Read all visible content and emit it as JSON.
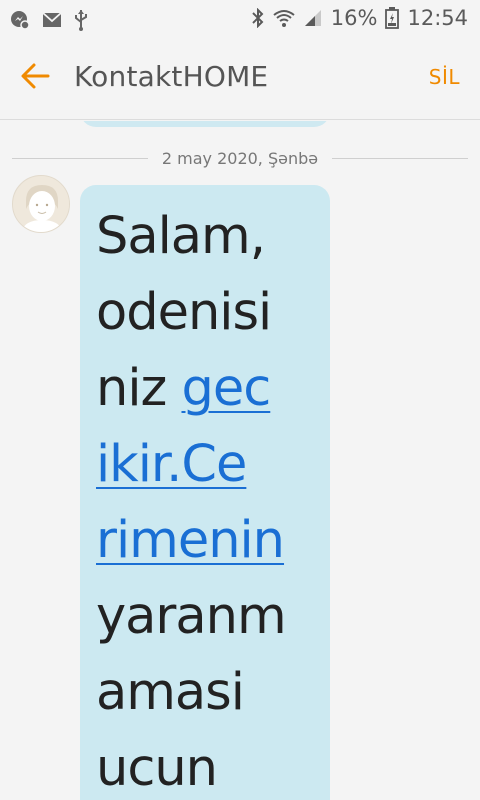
{
  "status_bar": {
    "battery": "16%",
    "time": "12:54",
    "icons": [
      "messenger-icon",
      "mail-icon",
      "usb-icon",
      "bluetooth-icon",
      "wifi-icon",
      "signal-icon",
      "battery-icon"
    ]
  },
  "app_bar": {
    "title": "KontaktHOME",
    "delete_label": "SİL",
    "accent_color": "#f08a00"
  },
  "conversation": {
    "date_divider": "2 may 2020, Şənbə",
    "message": {
      "lines": [
        {
          "text": "Salam,",
          "link": false
        },
        {
          "text": "odenisi",
          "link": false
        },
        {
          "prefix": "niz ",
          "link_text": "gec"
        },
        {
          "text": "ikir.Ce",
          "link": true
        },
        {
          "text": "rimenin",
          "link": true
        },
        {
          "text": "yaranm",
          "link": false
        },
        {
          "text": "amasi",
          "link": false
        },
        {
          "text": "ucun",
          "link": false
        }
      ],
      "bubble_color": "#cce9f1",
      "link_color": "#1a6fd4"
    }
  }
}
